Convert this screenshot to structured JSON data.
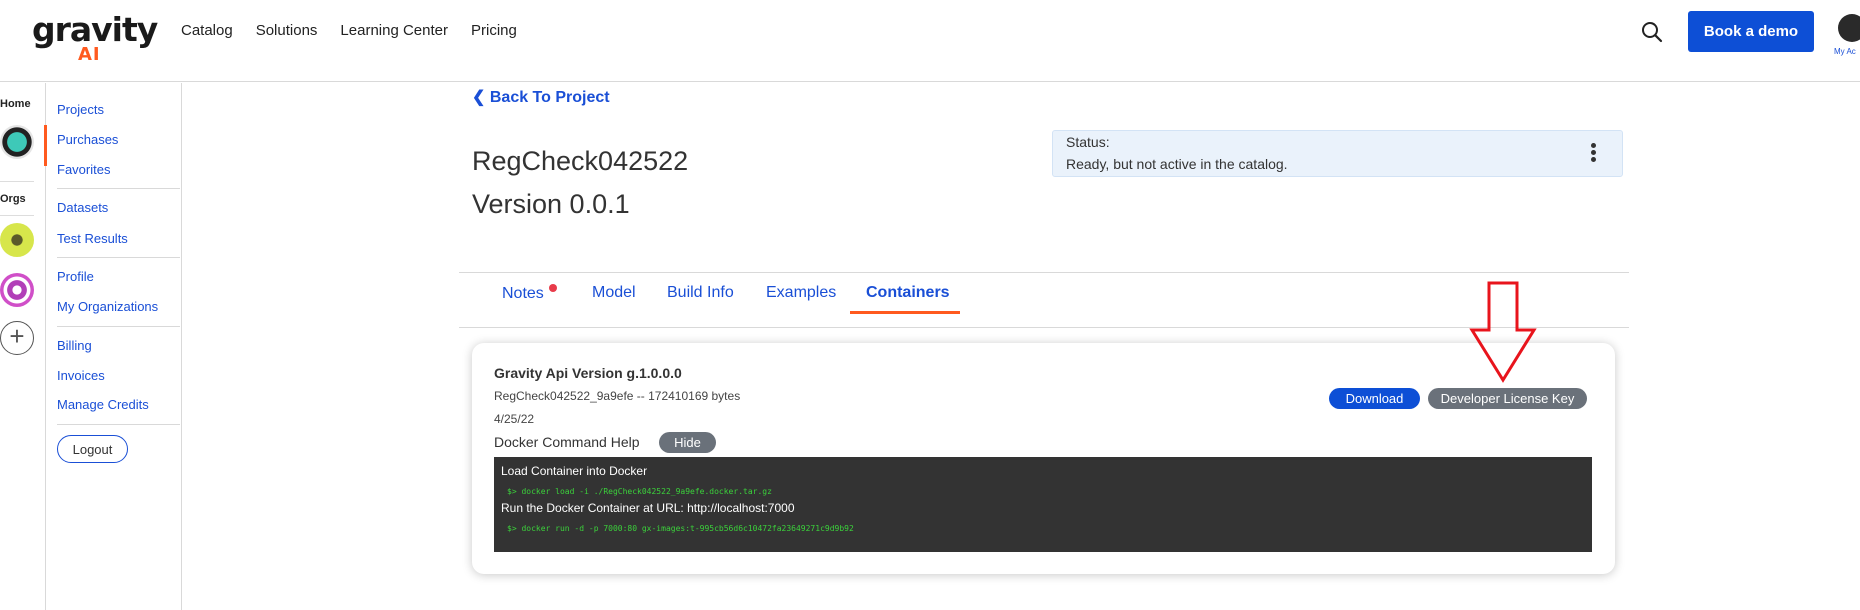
{
  "brand": {
    "word": "gravity",
    "ai": "AI"
  },
  "nav": {
    "links": [
      "Catalog",
      "Solutions",
      "Learning Center",
      "Pricing"
    ],
    "book_demo": "Book a demo",
    "account_label": "My Ac"
  },
  "rail": {
    "home_label": "Home",
    "orgs_label": "Orgs"
  },
  "sidebar": {
    "items": [
      "Projects",
      "Purchases",
      "Favorites",
      "Datasets",
      "Test Results",
      "Profile",
      "My Organizations",
      "Billing",
      "Invoices",
      "Manage Credits"
    ],
    "logout": "Logout"
  },
  "page": {
    "back": "Back To Project",
    "title": "RegCheck042522",
    "version": "Version 0.0.1"
  },
  "status": {
    "label": "Status:",
    "value": "Ready, but not active in the catalog."
  },
  "tabs": [
    "Notes",
    "Model",
    "Build Info",
    "Examples",
    "Containers"
  ],
  "active_tab": "Containers",
  "container": {
    "name": "Gravity Api Version g.1.0.0.0",
    "file": "RegCheck042522_9a9efe -- 172410169 bytes",
    "date": "4/25/22",
    "help_label": "Docker Command Help",
    "hide_label": "Hide",
    "download_label": "Download",
    "license_label": "Developer License Key",
    "load_heading": "Load Container into Docker",
    "load_cmd": "$> docker load -i ./RegCheck042522_9a9efe.docker.tar.gz",
    "run_heading": "Run the Docker Container at URL: http://localhost:7000",
    "run_cmd": "$> docker run -d -p 7000:80 gx-images:t-995cb56d6c10472fa23649271c9d9b92"
  },
  "colors": {
    "primary": "#0d4fd6",
    "accent": "#ff5a1f",
    "annotation_arrow": "#e8141c",
    "terminal_bg": "#333333",
    "terminal_text": "#3bd13b"
  }
}
